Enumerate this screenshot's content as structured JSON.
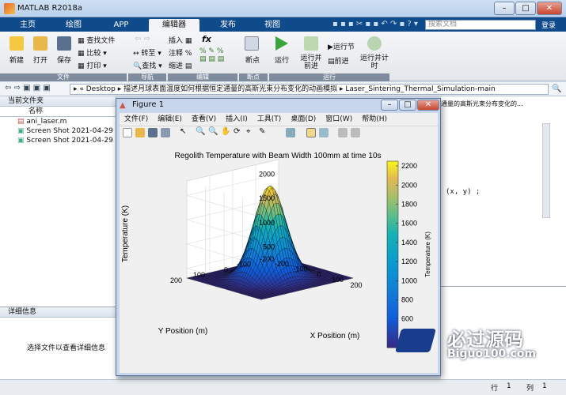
{
  "app": {
    "title": "MATLAB R2018a"
  },
  "tabs": [
    "主页",
    "绘图",
    "APP",
    "编辑器",
    "发布",
    "视图"
  ],
  "search_placeholder": "搜索文档",
  "user_label": "登录",
  "ribbon": {
    "file": [
      "新建",
      "打开",
      "保存"
    ],
    "file_small": [
      "查找文件",
      "比较",
      "打印"
    ],
    "nav": [
      "转至",
      "查找"
    ],
    "edit": [
      "插入",
      "注释",
      "缩进"
    ],
    "fx": "fx",
    "breakpoints": "断点",
    "run": [
      "运行",
      "运行并前进",
      "运行节",
      "前进",
      "运行并计时"
    ],
    "groups": [
      "文件",
      "导航",
      "编辑",
      "断点",
      "运行"
    ]
  },
  "address": {
    "root": "Desktop",
    "folder1": "描述月球表面温度如何根据恒定通量的高斯光束分布变化的动画模拟",
    "folder2": "Laser_Sintering_Thermal_Simulation-main"
  },
  "left_pane": {
    "title": "当前文件夹",
    "col": "名称",
    "files": [
      "ani_laser.m",
      "Screen Shot 2021-04-29 at",
      "Screen Shot 2021-04-29 at"
    ]
  },
  "details": {
    "title": "详细信息",
    "msg": "选择文件以查看详细信息"
  },
  "editor_snippets": [
    "通量的高斯光束分布变化的...",
    "(x, y) ;"
  ],
  "figure": {
    "title": "Figure 1",
    "menu": [
      "文件(F)",
      "编辑(E)",
      "查看(V)",
      "插入(I)",
      "工具(T)",
      "桌面(D)",
      "窗口(W)",
      "帮助(H)"
    ]
  },
  "status": {
    "row_label": "行",
    "row": "1",
    "col_label": "列",
    "col": "1"
  },
  "watermark": {
    "text": "必过源码",
    "url": "Biguo100.com"
  },
  "chart_data": {
    "type": "surface",
    "title": "Regolith Temperature with Beam Width 100mm at time 10s",
    "xlabel": "X Position (m)",
    "ylabel": "Y Position (m)",
    "zlabel": "Temperature (K)",
    "xlim": [
      -200,
      200
    ],
    "ylim": [
      -200,
      200
    ],
    "zlim": [
      300,
      2300
    ],
    "x_ticks": [
      -200,
      -100,
      0,
      100,
      200
    ],
    "y_ticks": [
      -200,
      -100,
      0,
      100,
      200
    ],
    "z_ticks": [
      500,
      1000,
      1500,
      2000
    ],
    "peak": 2200,
    "base": 300,
    "beam_width": 100,
    "colorbar": {
      "label": "Temperature (K)",
      "ticks": [
        600,
        800,
        1000,
        1200,
        1400,
        1600,
        1800,
        2000,
        2200
      ],
      "range": [
        300,
        2250
      ]
    },
    "colormap": "parula"
  }
}
